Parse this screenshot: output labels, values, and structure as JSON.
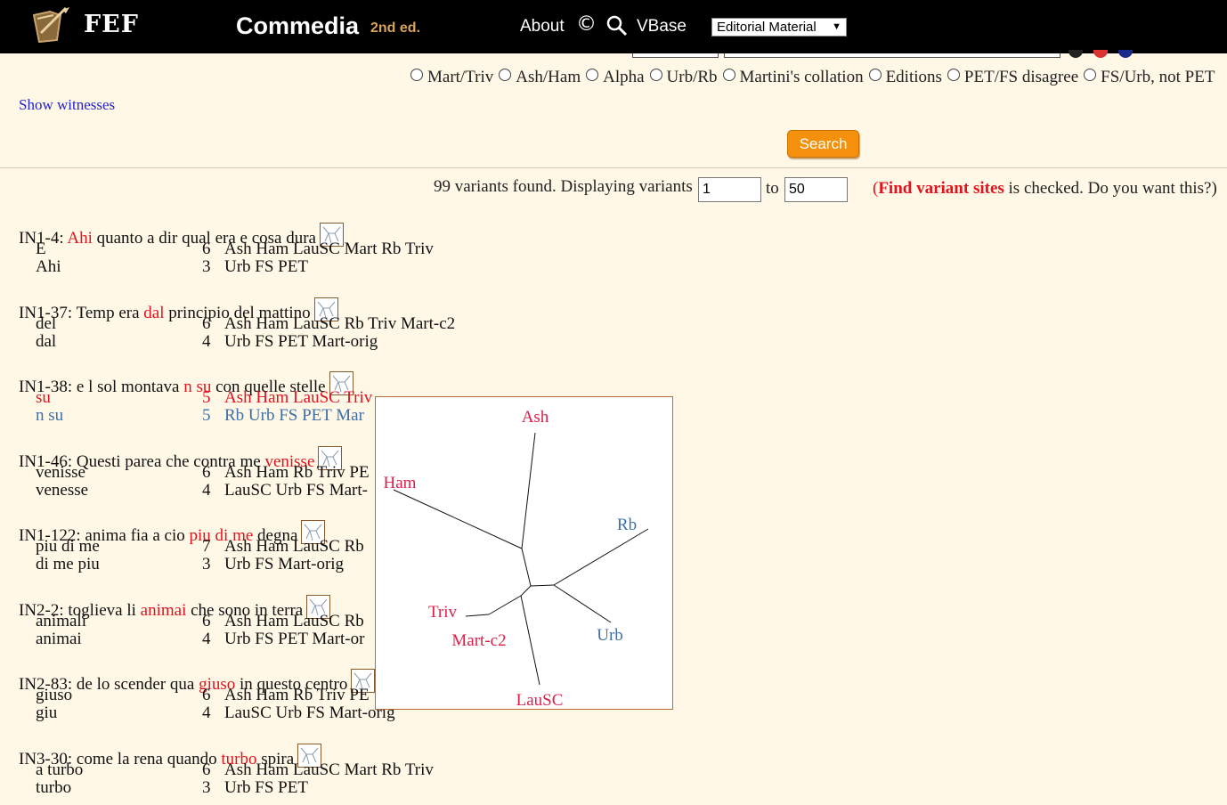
{
  "header": {
    "logo_text": "FEF",
    "title": "Commedia",
    "edition": "2nd ed.",
    "about": "About",
    "copyright_glyph": "©",
    "vbase": "VBase",
    "select_value": "Editorial Material"
  },
  "filters": {
    "options": [
      "Mart/Triv",
      "Ash/Ham",
      "Alpha",
      "Urb/Rb",
      "Martini's collation",
      "Editions",
      "PET/FS disagree",
      "FS/Urb, not PET"
    ]
  },
  "show_witnesses": "Show witnesses",
  "search_button": "Search",
  "results": {
    "count_text": "99 variants found. Displaying variants",
    "from_value": "1",
    "to_label": "to",
    "to_value": "50",
    "msg_open": "(",
    "msg_link": "Find variant sites",
    "msg_rest": " is checked. Do you want this?)"
  },
  "entries": [
    {
      "ref": "IN1-4:",
      "pre": "",
      "hl": "Ahi",
      "post": "quanto a dir qual era e cosa dura",
      "variants": [
        {
          "text": "E",
          "count": "6",
          "witnesses": "Ash Ham LauSC Mart Rb Triv"
        },
        {
          "text": "Ahi",
          "count": "3",
          "witnesses": "Urb FS PET"
        }
      ]
    },
    {
      "ref": "IN1-37:",
      "pre": "Temp era",
      "hl": "dal",
      "post": "principio del mattino",
      "variants": [
        {
          "text": "del",
          "count": "6",
          "witnesses": "Ash Ham LauSC Rb Triv Mart-c2"
        },
        {
          "text": "dal",
          "count": "4",
          "witnesses": "Urb FS PET Mart-orig"
        }
      ]
    },
    {
      "ref": "IN1-38:",
      "pre": "e l sol montava",
      "hl": "n su",
      "post": "con quelle stelle",
      "variants": [
        {
          "text": "su",
          "count": "5",
          "witnesses": "Ash Ham LauSC Triv"
        },
        {
          "text": "n su",
          "count": "5",
          "witnesses": "Rb Urb FS PET Mar"
        }
      ]
    },
    {
      "ref": "IN1-46:",
      "pre": "Questi parea che contra me",
      "hl": "venisse",
      "post": "",
      "variants": [
        {
          "text": "venisse",
          "count": "6",
          "witnesses": "Ash Ham Rb Triv PE"
        },
        {
          "text": "venesse",
          "count": "4",
          "witnesses": "LauSC Urb FS Mart-"
        }
      ]
    },
    {
      "ref": "IN1-122:",
      "pre": "anima fia a cio",
      "hl": "piu di me",
      "post": "degna",
      "variants": [
        {
          "text": "piu di me",
          "count": "7",
          "witnesses": "Ash Ham LauSC Rb"
        },
        {
          "text": "di me piu",
          "count": "3",
          "witnesses": "Urb FS Mart-orig"
        }
      ]
    },
    {
      "ref": "IN2-2:",
      "pre": "toglieva li",
      "hl": "animai",
      "post": "che sono in terra",
      "variants": [
        {
          "text": "animali",
          "count": "6",
          "witnesses": "Ash Ham LauSC Rb"
        },
        {
          "text": "animai",
          "count": "4",
          "witnesses": "Urb FS PET Mart-or"
        }
      ]
    },
    {
      "ref": "IN2-83:",
      "pre": "de lo scender qua",
      "hl": "giuso",
      "post": "in questo centro",
      "variants": [
        {
          "text": "giuso",
          "count": "6",
          "witnesses": "Ash Ham Rb Triv PE"
        },
        {
          "text": "giu",
          "count": "4",
          "witnesses": "LauSC Urb FS Mart-orig"
        }
      ]
    },
    {
      "ref": "IN3-30:",
      "pre": "come la rena quando",
      "hl": "turbo",
      "post": "spira",
      "variants": [
        {
          "text": "a turbo",
          "count": "6",
          "witnesses": "Ash Ham LauSC Mart Rb Triv"
        },
        {
          "text": "turbo",
          "count": "3",
          "witnesses": "Urb FS PET"
        }
      ]
    }
  ],
  "tree_popup": {
    "labels": [
      "Ash",
      "Ham",
      "Rb",
      "Triv",
      "Mart-c2",
      "Urb",
      "LauSC"
    ],
    "colors": {
      "group_a": "#dc1f4b",
      "group_b": "#3d6fa8"
    }
  },
  "colors": {
    "highlight": "#e0131f",
    "accent": "#f5900c",
    "link": "#2323d0"
  }
}
